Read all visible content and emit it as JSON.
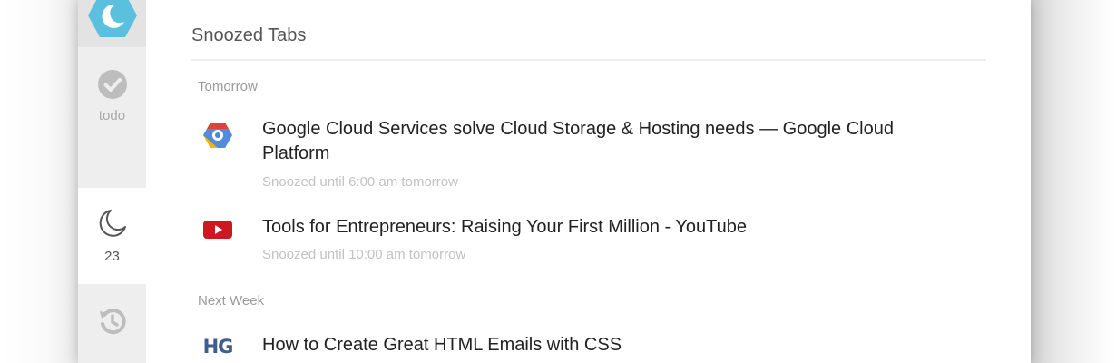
{
  "sidebar": {
    "logo_icon": "moon-hexagon-logo-icon",
    "todo": {
      "icon": "check-circle-icon",
      "label": "todo"
    },
    "snoozed": {
      "icon": "moon-icon",
      "count": "23"
    },
    "history": {
      "icon": "history-icon"
    }
  },
  "main": {
    "title": "Snoozed Tabs",
    "groups": [
      {
        "label": "Tomorrow",
        "items": [
          {
            "icon": "google-cloud-icon",
            "title": "Google Cloud Services solve Cloud Storage & Hosting needs — Google Cloud Platform",
            "snoozed_until": "Snoozed until 6:00 am tomorrow"
          },
          {
            "icon": "youtube-icon",
            "title": "Tools for Entrepreneurs: Raising Your First Million - YouTube",
            "snoozed_until": "Snoozed until 10:00 am tomorrow"
          }
        ]
      },
      {
        "label": "Next Week",
        "items": [
          {
            "icon": "hg-icon",
            "icon_text": "HG",
            "title": "How to Create Great HTML Emails with CSS"
          }
        ]
      }
    ]
  },
  "colors": {
    "accent": "#5bc0de",
    "sidebar_bg": "#eeeeee",
    "youtube_red": "#cc181e"
  }
}
